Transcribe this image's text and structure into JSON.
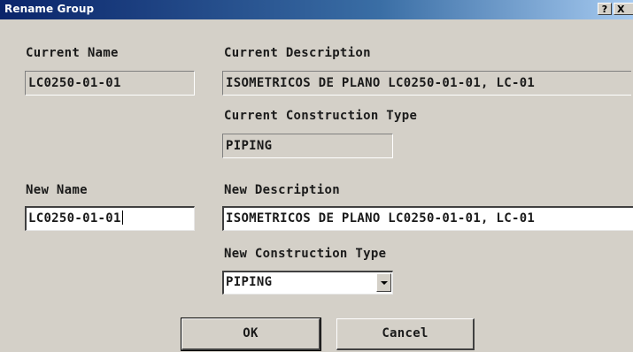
{
  "window": {
    "title": "Rename Group",
    "help_button": "?",
    "close_button": "X"
  },
  "current": {
    "name_label": "Current Name",
    "name_value": "LC0250-01-01",
    "description_label": "Current Description",
    "description_value": "ISOMETRICOS DE PLANO LC0250-01-01, LC-01",
    "construction_type_label": "Current Construction Type",
    "construction_type_value": "PIPING"
  },
  "new": {
    "name_label": "New Name",
    "name_value": "LC0250-01-01",
    "description_label": "New Description",
    "description_value": "ISOMETRICOS DE PLANO LC0250-01-01, LC-01",
    "construction_type_label": "New Construction Type",
    "construction_type_value": "PIPING"
  },
  "buttons": {
    "ok": "OK",
    "cancel": "Cancel"
  }
}
